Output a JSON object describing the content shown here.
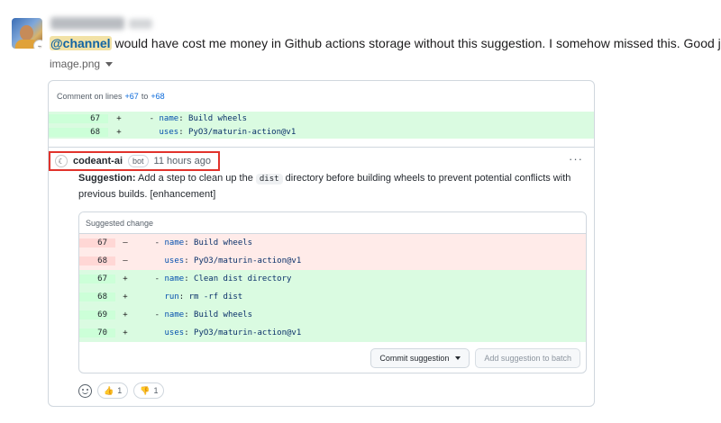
{
  "message": {
    "mention": "@channel",
    "text": " would have cost me money in Github actions storage without this suggestion. I somehow missed this. Good job",
    "attachment_name": "image.png"
  },
  "comment": {
    "lines_prefix": "Comment on lines",
    "line_start": "+67",
    "line_to": "to",
    "line_end": "+68",
    "context_rows": [
      {
        "num": "67",
        "sign": "+",
        "indent": "    - ",
        "key": "name",
        "value": "Build wheels"
      },
      {
        "num": "68",
        "sign": "+",
        "indent": "      ",
        "key": "uses",
        "value": "PyO3/maturin-action@v1"
      }
    ],
    "author": "codeant-ai",
    "bot_label": "bot",
    "time": "11 hours ago",
    "more": "···",
    "suggestion_label": "Suggestion:",
    "suggestion_before": " Add a step to clean up the ",
    "suggestion_code": "dist",
    "suggestion_after": " directory before building wheels to prevent potential conflicts with previous builds. [enhancement]"
  },
  "suggested_change": {
    "header": "Suggested change",
    "rows": [
      {
        "type": "del",
        "num": "67",
        "sign": "–",
        "indent": "    - ",
        "key": "name",
        "value": "Build wheels"
      },
      {
        "type": "del",
        "num": "68",
        "sign": "–",
        "indent": "      ",
        "key": "uses",
        "value": "PyO3/maturin-action@v1"
      },
      {
        "type": "add",
        "num": "67",
        "sign": "+",
        "indent": "    - ",
        "key": "name",
        "value": "Clean dist directory"
      },
      {
        "type": "add",
        "num": "68",
        "sign": "+",
        "indent": "      ",
        "key": "run",
        "value": "rm -rf dist"
      },
      {
        "type": "add",
        "num": "69",
        "sign": "+",
        "indent": "    - ",
        "key": "name",
        "value": "Build wheels"
      },
      {
        "type": "add",
        "num": "70",
        "sign": "+",
        "indent": "      ",
        "key": "uses",
        "value": "PyO3/maturin-action@v1"
      }
    ],
    "commit_label": "Commit suggestion",
    "batch_label": "Add suggestion to batch"
  },
  "reactions": [
    {
      "emoji": "👍",
      "count": "1"
    },
    {
      "emoji": "👎",
      "count": "1"
    }
  ]
}
